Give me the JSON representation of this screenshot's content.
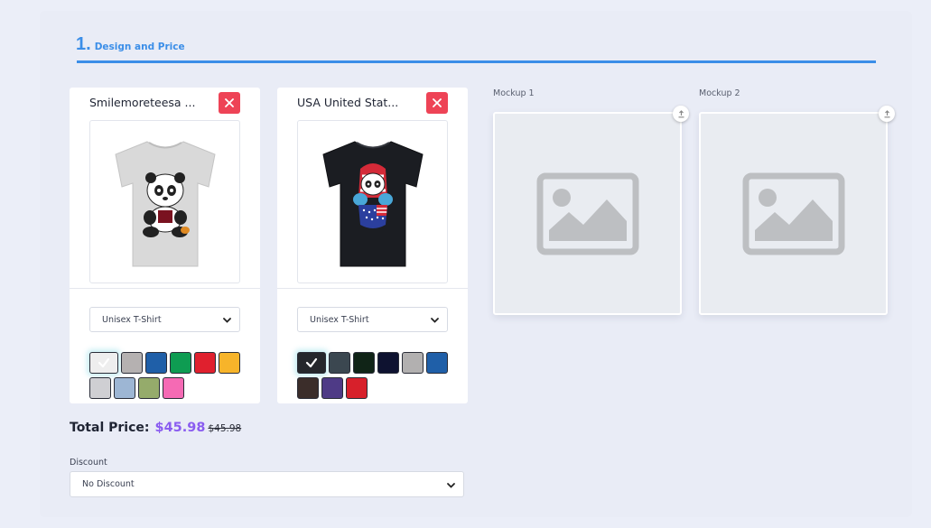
{
  "section": {
    "number": "1.",
    "title": "Design and Price"
  },
  "products": [
    {
      "title": "Smilemoreteesa ...",
      "product_type": "Unisex T-Shirt",
      "shirt_color": "#d9d9d9",
      "swatches": [
        {
          "color": "#eeeeee",
          "selected": true
        },
        {
          "color": "#b5b1b1",
          "selected": false
        },
        {
          "color": "#1f5fa8",
          "selected": false
        },
        {
          "color": "#0e9c52",
          "selected": false
        },
        {
          "color": "#e0202e",
          "selected": false
        },
        {
          "color": "#f7b42a",
          "selected": false
        },
        {
          "color": "#cfcfd3",
          "selected": false
        },
        {
          "color": "#9db6d4",
          "selected": false
        },
        {
          "color": "#95ab6b",
          "selected": false
        },
        {
          "color": "#f56ab4",
          "selected": false
        }
      ]
    },
    {
      "title": "USA United Stat...",
      "product_type": "Unisex T-Shirt",
      "shirt_color": "#1b1d22",
      "swatches": [
        {
          "color": "#25272c",
          "selected": true
        },
        {
          "color": "#3b4750",
          "selected": false
        },
        {
          "color": "#102417",
          "selected": false
        },
        {
          "color": "#0e1230",
          "selected": false
        },
        {
          "color": "#b2b0b0",
          "selected": false
        },
        {
          "color": "#1f5fa8",
          "selected": false
        },
        {
          "color": "#3b2d2a",
          "selected": false
        },
        {
          "color": "#4e3a86",
          "selected": false
        },
        {
          "color": "#d7202b",
          "selected": false
        }
      ]
    }
  ],
  "mockups": [
    {
      "label": "Mockup 1"
    },
    {
      "label": "Mockup 2"
    }
  ],
  "total": {
    "label": "Total Price:",
    "price": "$45.98",
    "original_price": "$45.98"
  },
  "discount": {
    "label": "Discount",
    "selected": "No Discount"
  },
  "colors": {
    "accent": "#3b8ee8",
    "price": "#8a5cf0",
    "remove": "#ee4356"
  },
  "icons": {
    "remove": "close-icon",
    "select": "chevron-down-icon",
    "upload": "upload-icon",
    "placeholder": "image-placeholder-icon",
    "selected_swatch": "checkmark-icon"
  }
}
